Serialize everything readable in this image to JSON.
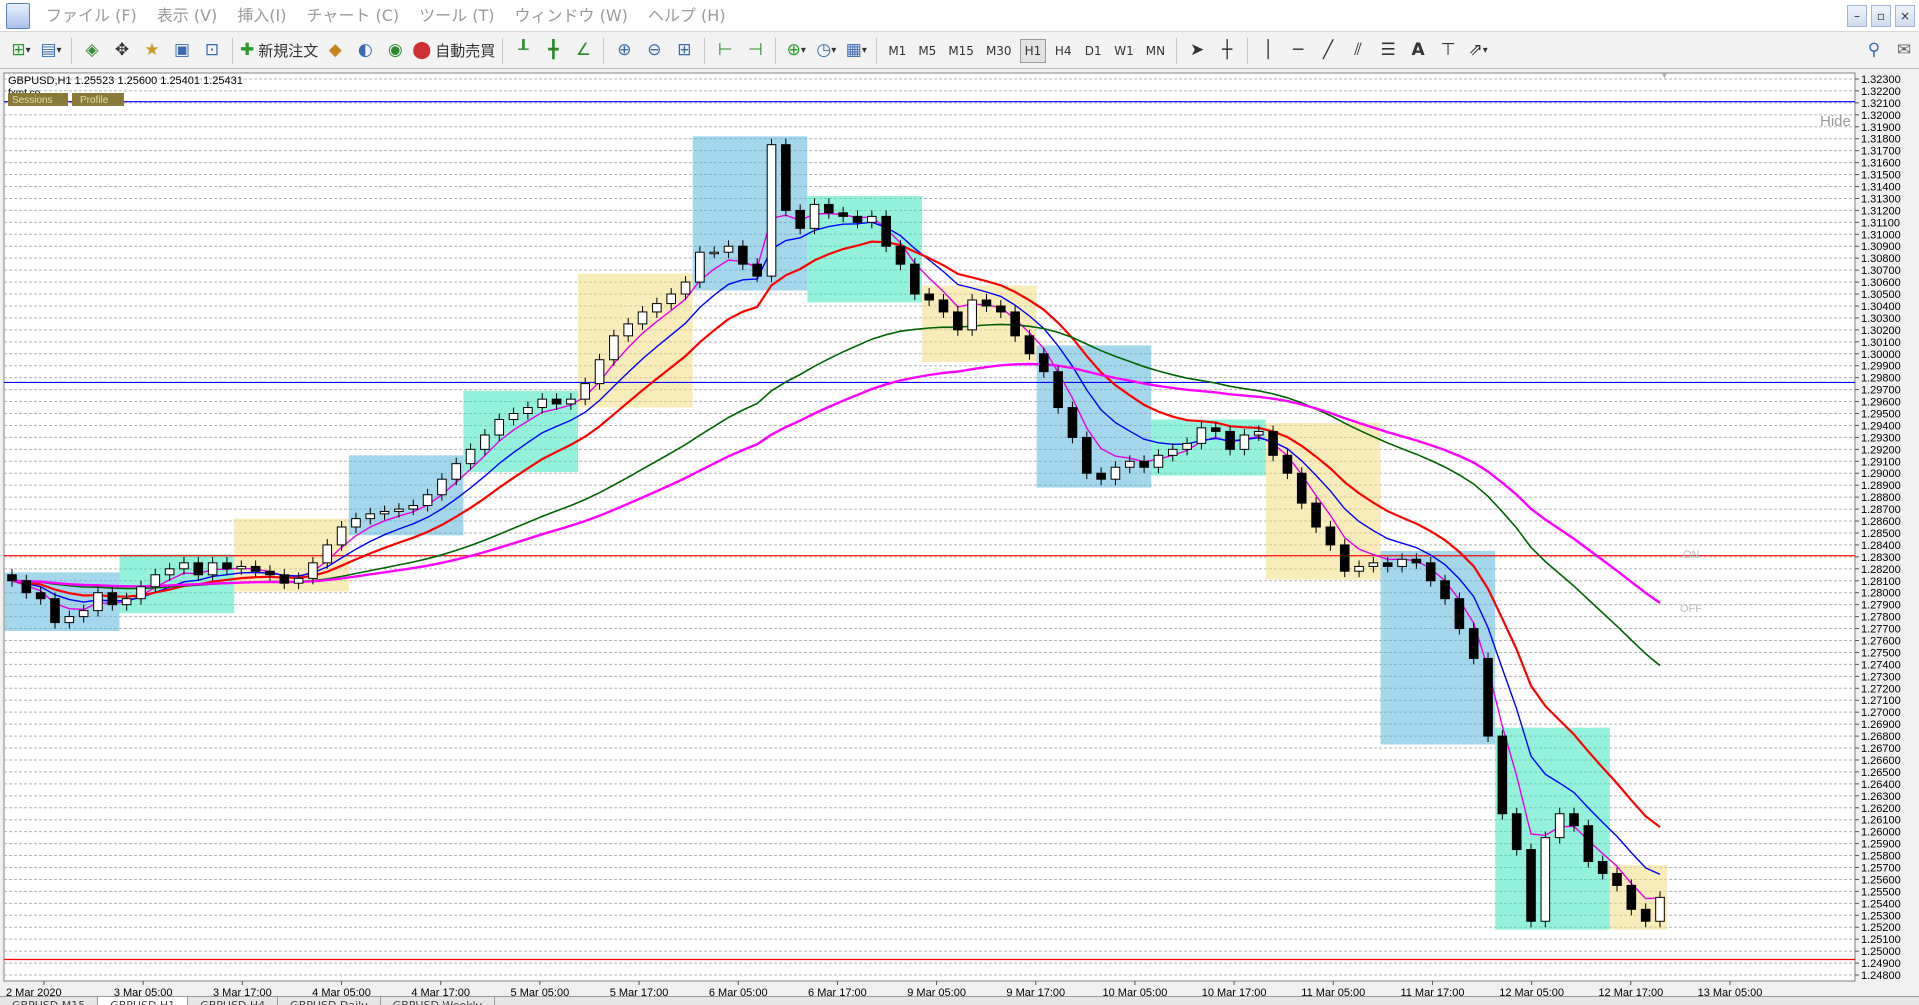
{
  "menu": [
    "ファイル (F)",
    "表示 (V)",
    "挿入(I)",
    "チャート (C)",
    "ツール (T)",
    "ウィンドウ (W)",
    "ヘルプ (H)"
  ],
  "window_controls": [
    "–",
    "▫",
    "×"
  ],
  "toolbar": {
    "new_order_label": "新規注文",
    "auto_trade_label": "自動売買",
    "timeframes": [
      "M1",
      "M5",
      "M15",
      "M30",
      "H1",
      "H4",
      "D1",
      "W1",
      "MN"
    ],
    "active_timeframe": "H1"
  },
  "chart": {
    "header": "GBPUSD,H1  1.25523 1.25600 1.25401 1.25431",
    "watermark": "fxmt.co",
    "sessions_label": "Sessions",
    "profile_label": "Profile",
    "hide_label": "Hide",
    "on_label": "ON",
    "off_label": "OFF",
    "x_labels": [
      "2 Mar 2020",
      "3 Mar 05:00",
      "3 Mar 17:00",
      "4 Mar 05:00",
      "4 Mar 17:00",
      "5 Mar 05:00",
      "5 Mar 17:00",
      "6 Mar 05:00",
      "6 Mar 17:00",
      "9 Mar 05:00",
      "9 Mar 17:00",
      "10 Mar 05:00",
      "10 Mar 17:00",
      "11 Mar 05:00",
      "11 Mar 17:00",
      "12 Mar 05:00",
      "12 Mar 17:00",
      "13 Mar 05:00"
    ],
    "y_labels": [
      "1.32300",
      "1.32200",
      "1.32100",
      "1.32000",
      "1.31900",
      "1.31800",
      "1.31700",
      "1.31600",
      "1.31500",
      "1.31400",
      "1.31300",
      "1.31200",
      "1.31100",
      "1.31000",
      "1.30900",
      "1.30800",
      "1.30700",
      "1.30600",
      "1.30500",
      "1.30400",
      "1.30300",
      "1.30200",
      "1.30100",
      "1.30000",
      "1.29900",
      "1.29800",
      "1.29700",
      "1.29600",
      "1.29500",
      "1.29400",
      "1.29300",
      "1.29200",
      "1.29100",
      "1.29000",
      "1.28900",
      "1.28800",
      "1.28700",
      "1.28600",
      "1.28500",
      "1.28400",
      "1.28300",
      "1.28200",
      "1.28100",
      "1.28000",
      "1.27900",
      "1.27800",
      "1.27700",
      "1.27600",
      "1.27500",
      "1.27400",
      "1.27300",
      "1.27200",
      "1.27100",
      "1.27000",
      "1.26900",
      "1.26800",
      "1.26700",
      "1.26600",
      "1.26500",
      "1.26400",
      "1.26300",
      "1.26200",
      "1.26100",
      "1.26000",
      "1.25900",
      "1.25800",
      "1.25700",
      "1.25600",
      "1.25500",
      "1.25400",
      "1.25300",
      "1.25200",
      "1.25100",
      "1.25000",
      "1.24900",
      "1.24800"
    ],
    "colors": {
      "background": "#ffffff",
      "grid": "#b4b4b4",
      "asia": "#5ab4dc",
      "europe": "#3ce6c0",
      "america": "#f0dc82",
      "fast_ma": "#e600e6",
      "mid_ma": "#0000ff",
      "slow_ma": "#ff0000",
      "long_ma": "#006400",
      "very_long_ma": "#ff00ff",
      "level_blue": "#0000ff",
      "level_red": "#ff0000"
    },
    "levels": {
      "blue_top": 1.3211,
      "blue_mid": 1.2976,
      "red_mid": 1.2831,
      "red_bottom": 1.2493
    },
    "close_series": [
      1.281,
      1.28,
      1.2795,
      1.2775,
      1.278,
      1.2785,
      1.28,
      1.279,
      1.2795,
      1.2805,
      1.2815,
      1.282,
      1.2825,
      1.2815,
      1.2825,
      1.282,
      1.2822,
      1.2818,
      1.2815,
      1.2808,
      1.2812,
      1.2825,
      1.284,
      1.2855,
      1.2862,
      1.2866,
      1.2868,
      1.287,
      1.2873,
      1.2882,
      1.2895,
      1.2908,
      1.292,
      1.2932,
      1.2945,
      1.295,
      1.2955,
      1.2962,
      1.2958,
      1.2962,
      1.2975,
      1.2995,
      1.3015,
      1.3025,
      1.3035,
      1.3042,
      1.305,
      1.306,
      1.3085,
      1.3085,
      1.309,
      1.3075,
      1.3065,
      1.3175,
      1.312,
      1.3105,
      1.3125,
      1.3118,
      1.3115,
      1.311,
      1.3115,
      1.309,
      1.3075,
      1.305,
      1.3045,
      1.3035,
      1.302,
      1.3045,
      1.304,
      1.3035,
      1.3015,
      1.3,
      1.2985,
      1.2955,
      1.293,
      1.29,
      1.2895,
      1.2905,
      1.291,
      1.2905,
      1.2915,
      1.292,
      1.2925,
      1.2938,
      1.2935,
      1.292,
      1.2932,
      1.2935,
      1.2915,
      1.29,
      1.2875,
      1.2855,
      1.284,
      1.2818,
      1.2822,
      1.2825,
      1.2822,
      1.2828,
      1.2825,
      1.281,
      1.2795,
      1.277,
      1.2745,
      1.268,
      1.2615,
      1.2585,
      1.2525,
      1.2595,
      1.2615,
      1.2605,
      1.2575,
      1.2565,
      1.2555,
      1.2535,
      1.2525,
      1.2545
    ]
  },
  "bottom_tabs": [
    "GBPUSD,M15",
    "GBPUSD,H1",
    "GBPUSD,H4",
    "GBPUSD,Daily",
    "GBPUSD,Weekly"
  ],
  "active_tab": "GBPUSD,H1"
}
